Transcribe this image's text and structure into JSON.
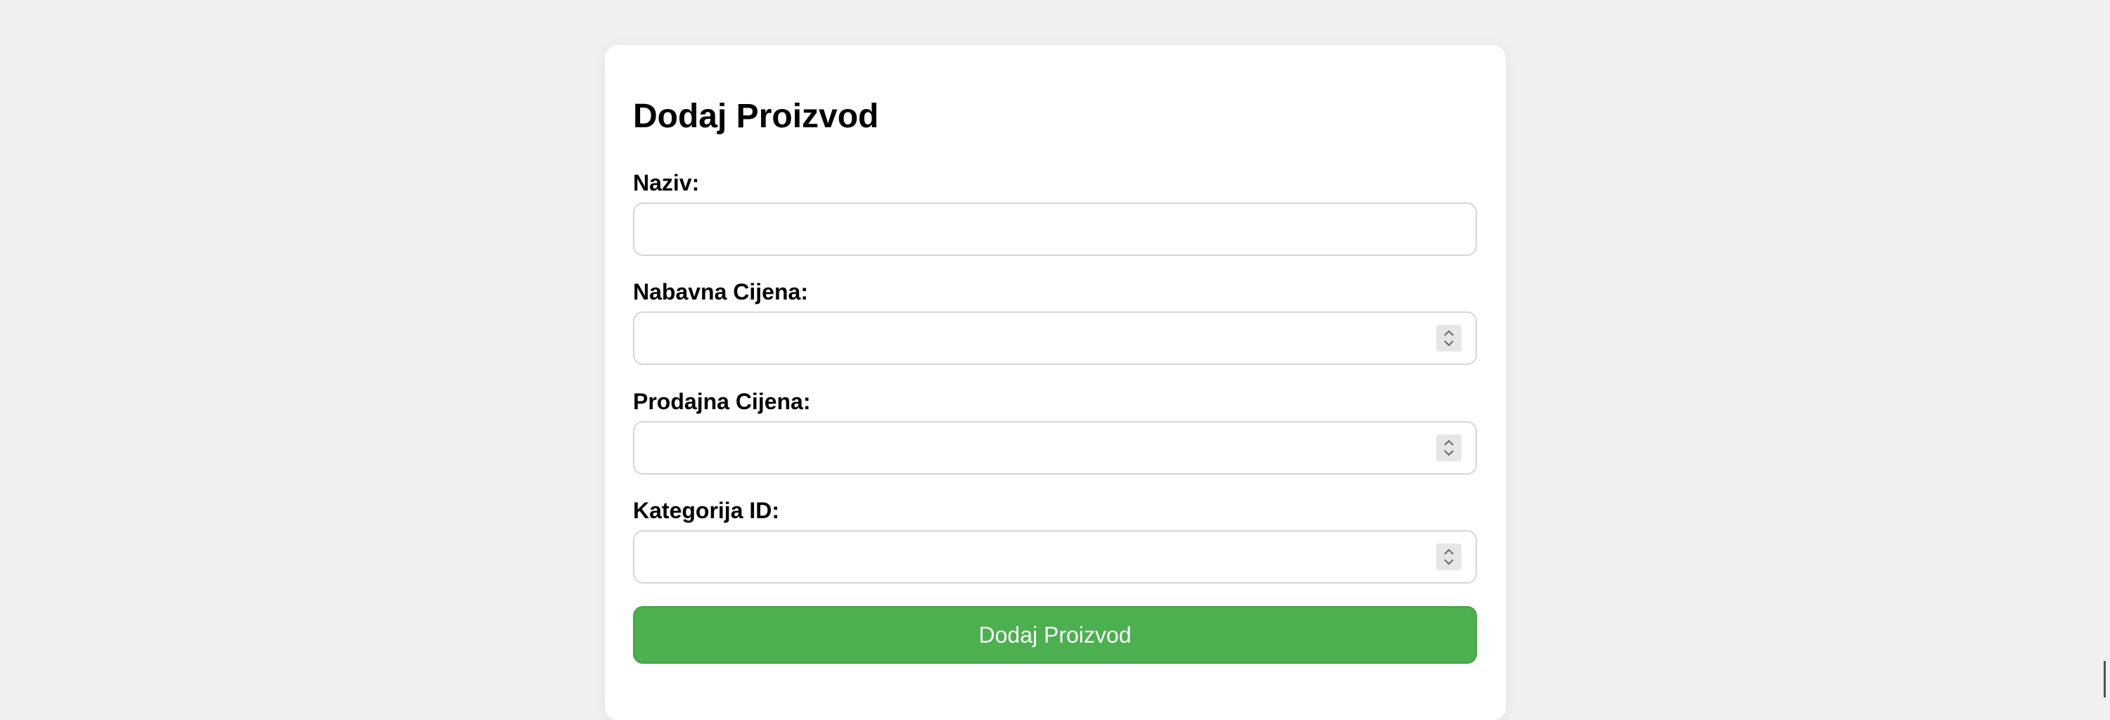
{
  "form": {
    "title": "Dodaj Proizvod",
    "fields": [
      {
        "label": "Naziv:",
        "value": "",
        "type": "text"
      },
      {
        "label": "Nabavna Cijena:",
        "value": "",
        "type": "number"
      },
      {
        "label": "Prodajna Cijena:",
        "value": "",
        "type": "number"
      },
      {
        "label": "Kategorija ID:",
        "value": "",
        "type": "number"
      }
    ],
    "submit_label": "Dodaj Proizvod"
  },
  "icons": {
    "spinner": "number-spinner-icon"
  },
  "colors": {
    "background": "#f0f0f0",
    "card": "#ffffff",
    "accent": "#4caf50"
  }
}
